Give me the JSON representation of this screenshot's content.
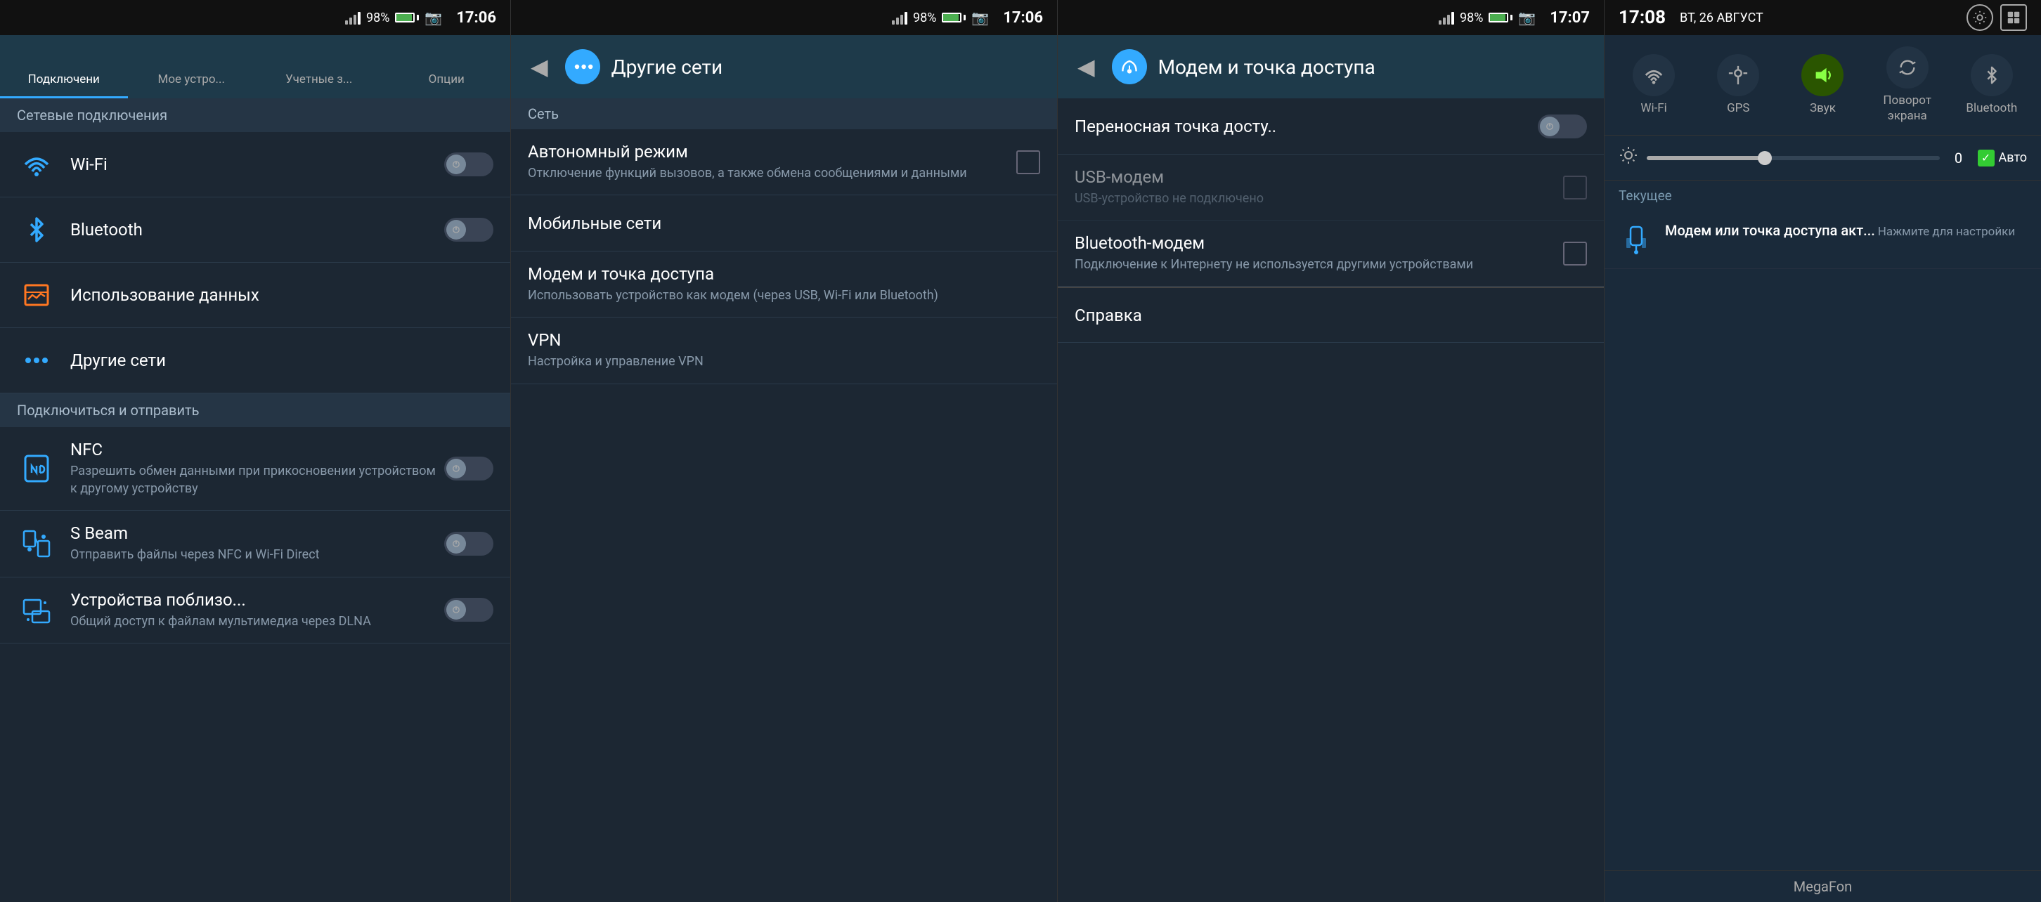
{
  "panel1": {
    "statusBar": {
      "signal": "98%",
      "time": "17:06",
      "photo": "📷"
    },
    "tabs": [
      {
        "id": "connections",
        "label": "Подключени",
        "icon": "connections",
        "active": true
      },
      {
        "id": "my-device",
        "label": "Мое устро...",
        "icon": "device",
        "active": false
      },
      {
        "id": "accounts",
        "label": "Учетные з...",
        "icon": "accounts",
        "active": false
      },
      {
        "id": "options",
        "label": "Опции",
        "icon": "options",
        "active": false
      }
    ],
    "sectionHeader": "Сетевые подключения",
    "items": [
      {
        "id": "wifi",
        "title": "Wi-Fi",
        "icon": "wifi",
        "toggle": true,
        "toggleState": "off"
      },
      {
        "id": "bluetooth",
        "title": "Bluetooth",
        "icon": "bluetooth",
        "toggle": true,
        "toggleState": "off"
      }
    ],
    "section2Header": "Использование данных",
    "items2": [
      {
        "id": "data-usage",
        "title": "Использование данных",
        "icon": "data",
        "toggle": false
      }
    ],
    "items3": [
      {
        "id": "other-networks",
        "title": "Другие сети",
        "icon": "networks",
        "toggle": false
      }
    ],
    "section3Header": "Подключиться и отправить",
    "items4": [
      {
        "id": "nfc",
        "title": "NFC",
        "subtitle": "Разрешить обмен данными при прикосновении устройством к другому устройству",
        "icon": "nfc",
        "toggle": true,
        "toggleState": "off"
      },
      {
        "id": "sbeam",
        "title": "S Beam",
        "subtitle": "Отправить файлы через NFC и Wi-Fi Direct",
        "icon": "sbeam",
        "toggle": true,
        "toggleState": "off"
      },
      {
        "id": "nearby",
        "title": "Устройства поблизо...",
        "subtitle": "Общий доступ к файлам мультимедиа через DLNA",
        "icon": "nearby",
        "toggle": true,
        "toggleState": "off"
      }
    ]
  },
  "panel2": {
    "statusBar": {
      "signal": "98%",
      "time": "17:06",
      "photo": "📷"
    },
    "header": {
      "title": "Другие сети",
      "backLabel": "◀"
    },
    "divider": "Сеть",
    "items": [
      {
        "id": "airplane",
        "title": "Автономный режим",
        "subtitle": "Отключение функций вызовов, а также обмена сообщениями и данными",
        "checkbox": true
      },
      {
        "id": "mobile-networks",
        "title": "Мобильные сети",
        "subtitle": ""
      },
      {
        "id": "modem-hotspot",
        "title": "Модем и точка доступа",
        "subtitle": "Использовать устройство как модем (через USB, Wi-Fi или Bluetooth)"
      },
      {
        "id": "vpn",
        "title": "VPN",
        "subtitle": "Настройка и управление VPN"
      }
    ]
  },
  "panel3": {
    "statusBar": {
      "signal": "98%",
      "time": "17:07",
      "photo": "📷"
    },
    "header": {
      "title": "Модем и точка доступа",
      "backLabel": "◀"
    },
    "items": [
      {
        "id": "portable-hotspot",
        "title": "Переносная точка досту..",
        "subtitle": "",
        "toggle": true,
        "toggleState": "off"
      },
      {
        "id": "usb-modem",
        "title": "USB-модем",
        "subtitle": "USB-устройство не подключено",
        "checkbox": true,
        "disabled": true
      },
      {
        "id": "bt-modem",
        "title": "Bluetooth-модем",
        "subtitle": "Подключение к Интернету не используется другими устройствами",
        "checkbox": true
      },
      {
        "id": "help",
        "title": "Справка",
        "subtitle": ""
      }
    ]
  },
  "panel4": {
    "statusBar": {
      "time": "17:08",
      "date": "ВТ, 26 АВГУСТ"
    },
    "toggles": [
      {
        "id": "wifi",
        "label": "Wi-Fi",
        "icon": "wifi",
        "active": false
      },
      {
        "id": "gps",
        "label": "GPS",
        "icon": "gps",
        "active": false
      },
      {
        "id": "sound",
        "label": "Звук",
        "icon": "sound",
        "active": true,
        "color": "green"
      },
      {
        "id": "rotate",
        "label": "Поворот экрана",
        "icon": "rotate",
        "active": false
      },
      {
        "id": "bluetooth",
        "label": "Bluetooth",
        "icon": "bluetooth",
        "active": false
      }
    ],
    "brightness": {
      "value": "0",
      "auto": "Авто",
      "fillPercent": 40
    },
    "currentSection": "Текущее",
    "notifications": [
      {
        "id": "hotspot",
        "icon": "usb",
        "title": "Модем или точка доступа акт...",
        "subtitle": "Нажмите для настройки"
      }
    ],
    "carrier": "MegaFon"
  }
}
